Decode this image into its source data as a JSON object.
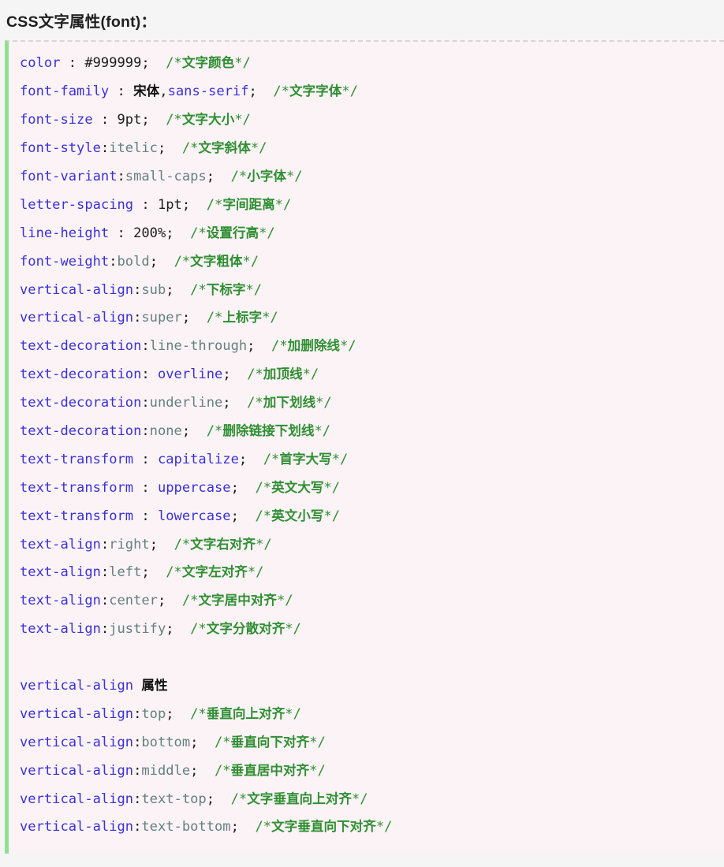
{
  "page": {
    "title": "CSS文字属性(font)：",
    "background_color": "#f6f5f5",
    "code_block": {
      "background_color": "#fcf3f6",
      "left_border_color": "#8fdf90",
      "top_border_color": "#ddd2d6",
      "top_border_style": "dashed"
    },
    "syntax_colors": {
      "property": "#3a31d8",
      "value_keyword": "#64807f",
      "value_literal": "#1d1d1d",
      "comment": "#2f8f33",
      "punctuation": "#1d1d1d",
      "chinese_text": "#111111"
    }
  },
  "code_lines": [
    {
      "property": "color",
      "sep": " : ",
      "value": "#999999",
      "value_kind": "literal",
      "terminator": ";",
      "comment": "/*文字颜色*/"
    },
    {
      "property": "font-family",
      "sep": " : ",
      "value": "宋体,sans-serif",
      "value_kind": "mixed",
      "terminator": ";",
      "comment": "/*文字字体*/"
    },
    {
      "property": "font-size",
      "sep": " : ",
      "value": "9pt",
      "value_kind": "literal",
      "terminator": ";",
      "comment": "/*文字大小*/"
    },
    {
      "property": "font-style",
      "sep": ":",
      "value": "itelic",
      "value_kind": "keyword",
      "terminator": ";",
      "comment": "/*文字斜体*/"
    },
    {
      "property": "font-variant",
      "sep": ":",
      "value": "small-caps",
      "value_kind": "keyword",
      "terminator": ";",
      "comment": "/*小字体*/"
    },
    {
      "property": "letter-spacing",
      "sep": " : ",
      "value": "1pt",
      "value_kind": "literal",
      "terminator": ";",
      "comment": "/*字间距离*/"
    },
    {
      "property": "line-height",
      "sep": " : ",
      "value": "200%",
      "value_kind": "literal",
      "terminator": ";",
      "comment": "/*设置行高*/"
    },
    {
      "property": "font-weight",
      "sep": ":",
      "value": "bold",
      "value_kind": "keyword",
      "terminator": ";",
      "comment": "/*文字粗体*/"
    },
    {
      "property": "vertical-align",
      "sep": ":",
      "value": "sub",
      "value_kind": "keyword",
      "terminator": ";",
      "comment": "/*下标字*/"
    },
    {
      "property": "vertical-align",
      "sep": ":",
      "value": "super",
      "value_kind": "keyword",
      "terminator": ";",
      "comment": "/*上标字*/"
    },
    {
      "property": "text-decoration",
      "sep": ":",
      "value": "line-through",
      "value_kind": "keyword",
      "terminator": ";",
      "comment": "/*加删除线*/"
    },
    {
      "property": "text-decoration",
      "sep": ": ",
      "value": "overline",
      "value_kind": "keyword_blue",
      "terminator": ";",
      "comment": "/*加顶线*/"
    },
    {
      "property": "text-decoration",
      "sep": ":",
      "value": "underline",
      "value_kind": "keyword",
      "terminator": ";",
      "comment": "/*加下划线*/"
    },
    {
      "property": "text-decoration",
      "sep": ":",
      "value": "none",
      "value_kind": "keyword",
      "terminator": ";",
      "comment": "/*删除链接下划线*/"
    },
    {
      "property": "text-transform",
      "sep": " : ",
      "value": "capitalize",
      "value_kind": "keyword_blue",
      "terminator": ";",
      "comment": "/*首字大写*/"
    },
    {
      "property": "text-transform",
      "sep": " : ",
      "value": "uppercase",
      "value_kind": "keyword_blue",
      "terminator": ";",
      "comment": "/*英文大写*/"
    },
    {
      "property": "text-transform",
      "sep": " : ",
      "value": "lowercase",
      "value_kind": "keyword_blue",
      "terminator": ";",
      "comment": "/*英文小写*/"
    },
    {
      "property": "text-align",
      "sep": ":",
      "value": "right",
      "value_kind": "keyword",
      "terminator": ";",
      "comment": "/*文字右对齐*/"
    },
    {
      "property": "text-align",
      "sep": ":",
      "value": "left",
      "value_kind": "keyword",
      "terminator": ";",
      "comment": "/*文字左对齐*/"
    },
    {
      "property": "text-align",
      "sep": ":",
      "value": "center",
      "value_kind": "keyword",
      "terminator": ";",
      "comment": "/*文字居中对齐*/"
    },
    {
      "property": "text-align",
      "sep": ":",
      "value": "justify",
      "value_kind": "keyword",
      "terminator": ";",
      "comment": "/*文字分散对齐*/"
    },
    {
      "blank": true
    },
    {
      "property": "vertical-align",
      "sep": " ",
      "value": "属性",
      "value_kind": "chinese_heading",
      "terminator": "",
      "comment": ""
    },
    {
      "property": "vertical-align",
      "sep": ":",
      "value": "top",
      "value_kind": "keyword",
      "terminator": ";",
      "comment": "/*垂直向上对齐*/"
    },
    {
      "property": "vertical-align",
      "sep": ":",
      "value": "bottom",
      "value_kind": "keyword",
      "terminator": ";",
      "comment": "/*垂直向下对齐*/"
    },
    {
      "property": "vertical-align",
      "sep": ":",
      "value": "middle",
      "value_kind": "keyword",
      "terminator": ";",
      "comment": "/*垂直居中对齐*/"
    },
    {
      "property": "vertical-align",
      "sep": ":",
      "value": "text-top",
      "value_kind": "keyword",
      "terminator": ";",
      "comment": "/*文字垂直向上对齐*/"
    },
    {
      "property": "vertical-align",
      "sep": ":",
      "value": "text-bottom",
      "value_kind": "keyword",
      "terminator": ";",
      "comment": "/*文字垂直向下对齐*/"
    }
  ]
}
